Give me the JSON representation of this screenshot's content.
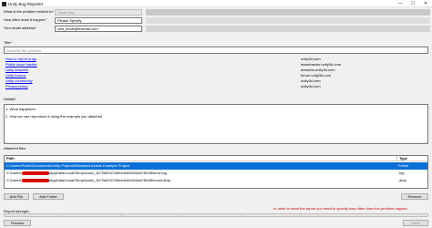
{
  "window": {
    "title": "Unity Bug Reporter",
    "minimize": "—",
    "maximize": "☐",
    "close": "✕"
  },
  "form": {
    "problem_label": "What is the problem related to*",
    "problem_value": "Crash bug",
    "frequency_label": "How often does it happen*",
    "frequency_value": "Please Specify",
    "email_label": "Your email address*",
    "email_value": "rafa_bunbi@hotmail.com",
    "title_label": "Title*",
    "title_placeholder": "Describe the problem"
  },
  "links": [
    {
      "label": "How to report bugs",
      "url": "unity3d.com"
    },
    {
      "label": "Public issue tracker",
      "url": "issuetracker.unity3d.com"
    },
    {
      "label": "Unity answers",
      "url": "answers.unity3d.com"
    },
    {
      "label": "Unity forums",
      "url": "forum.unity3d.com"
    },
    {
      "label": "Unity community",
      "url": "unity3d.com"
    },
    {
      "label": "Privacy policy",
      "url": "unity3d.com"
    }
  ],
  "details": {
    "label": "Details*",
    "line1": "1. What happened",
    "line2": "2. How we can reproduce it using the example you attached"
  },
  "attached": {
    "label": "Attached files",
    "col_path": "Path",
    "col_type": "Type",
    "rows": [
      {
        "path": "C:\\Users\\Public\\Documents\\Unity Projects\\Standard Assets Example Project",
        "type": "Folder"
      },
      {
        "path_pre": "C:\\Users\\",
        "path_post": "\\AppData\\Local\\Temp\\crash_1b72eb047c9fee4e6b049da74545f\\error.log",
        "type": ".log"
      },
      {
        "path_pre": "C:\\Users\\",
        "path_post": "\\AppData\\Local\\Temp\\crash_1b72eb047c9fee4e6b049da74545f\\crash.dmp",
        "type": ".dmp"
      }
    ]
  },
  "buttons": {
    "add_file": "Add File",
    "add_folder": "Add Folder",
    "remove": "Remove",
    "preview": "Preview",
    "send": "Send"
  },
  "warning": "In order to send the report you need to specify how often does the problem happen",
  "strength_label": "Report strength:",
  "colors": {
    "accent": "#0a6fd6",
    "warning": "#c00000",
    "link": "#0000ee"
  }
}
